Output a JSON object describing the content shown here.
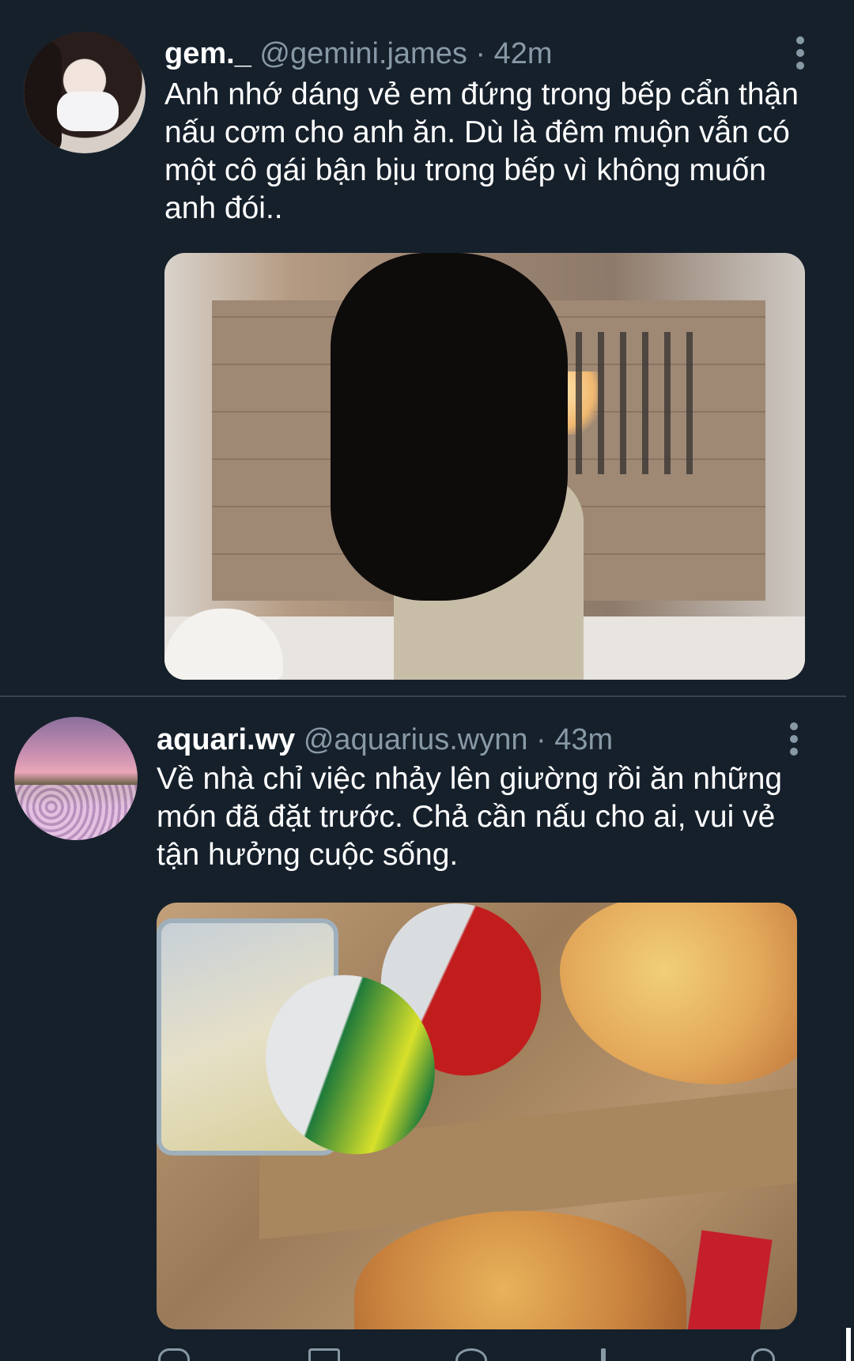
{
  "tweets": [
    {
      "display_name": "gem._",
      "handle": "@gemini.james",
      "separator": "·",
      "time": "42m",
      "text": "Anh nhớ dáng vẻ em đứng trong bếp cẩn thận nấu cơm cho anh ăn. Dù là đêm muộn vẫn có một cô gái bận bịu trong bếp vì không muốn anh đói..",
      "media_description": "kitchen-photo"
    },
    {
      "display_name": "aquari.wy",
      "handle": "@aquarius.wynn",
      "separator": "·",
      "time": "43m",
      "text": "Về nhà chỉ việc nhảy lên giường rồi ăn những món đã đặt trước. Chả cần nấu cho ai, vui vẻ tận hưởng cuộc sống.",
      "media_description": "pizza-and-soda-photo"
    }
  ],
  "icons": {
    "more": "more-vertical-icon",
    "reply": "reply-icon",
    "retweet": "retweet-icon",
    "like": "like-icon",
    "share": "share-icon"
  },
  "colors": {
    "background": "#15202b",
    "secondary_text": "#8899a6",
    "divider": "#38444d",
    "primary_text": "#ffffff"
  }
}
